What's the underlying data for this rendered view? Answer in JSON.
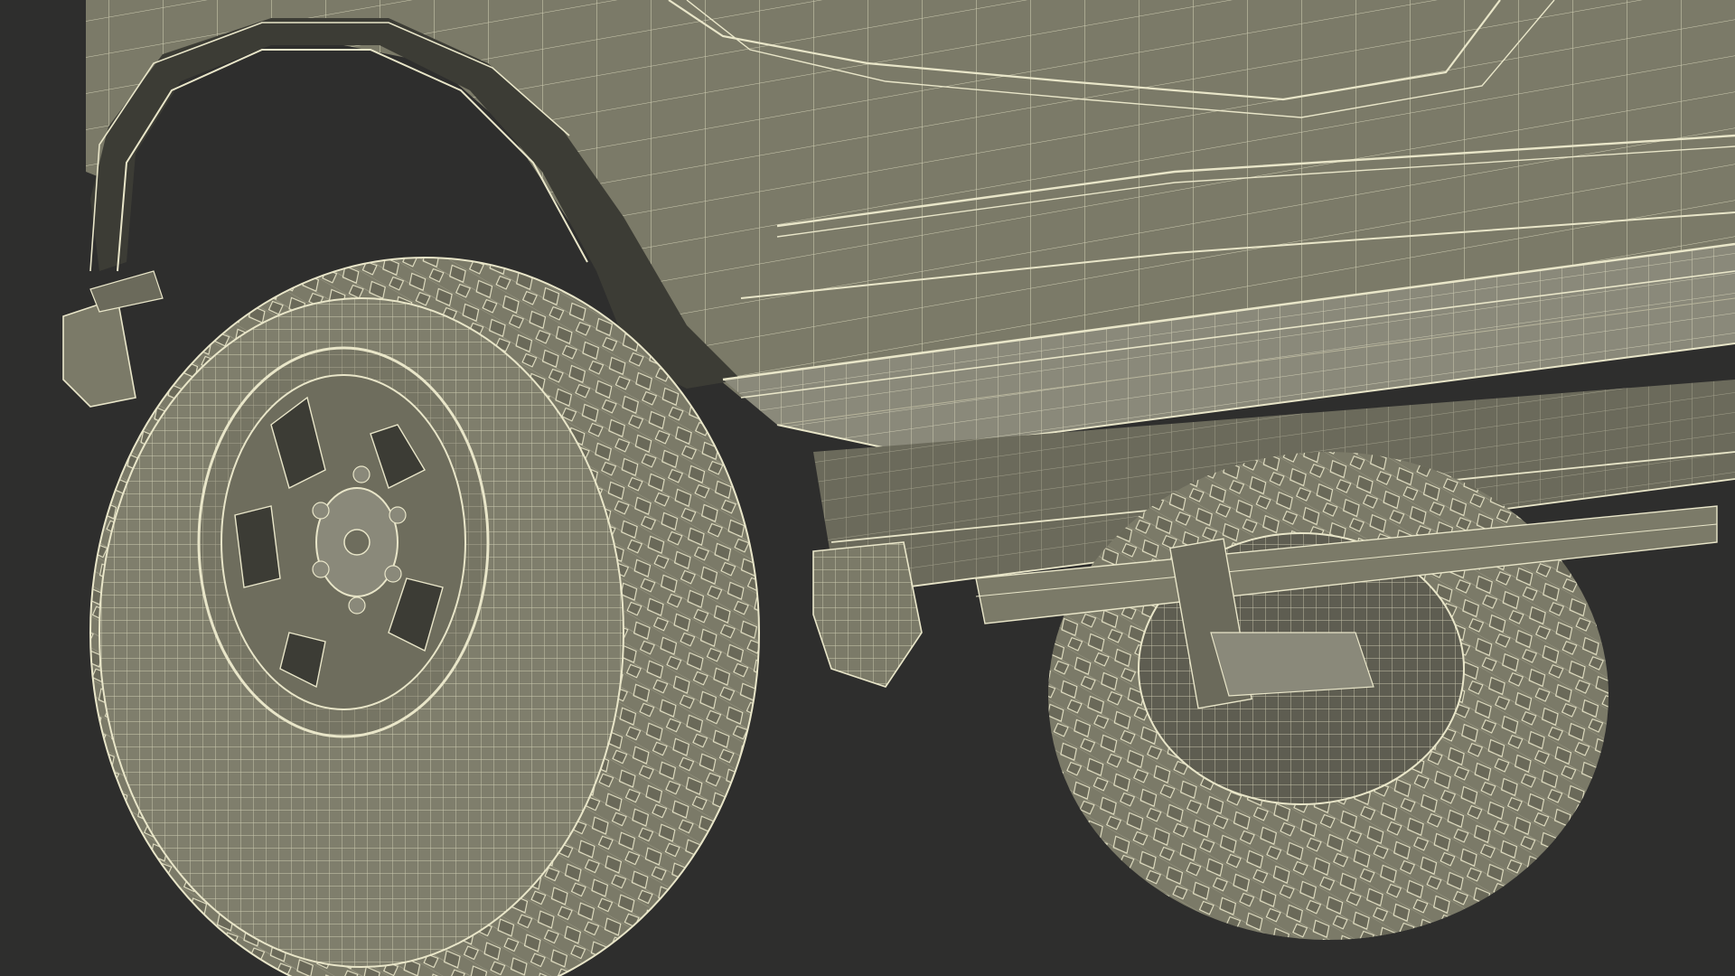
{
  "scene": {
    "subject": "offroad-vehicle-wireframe-render",
    "colors": {
      "background": "#2e2e2d",
      "surface": "#7b7a68",
      "surface_light": "#8a897a",
      "surface_dark": "#5e5d51",
      "shadow": "#3c3c35",
      "wire": "#e9e6c9",
      "wire_dim": "#b8b59c"
    }
  }
}
